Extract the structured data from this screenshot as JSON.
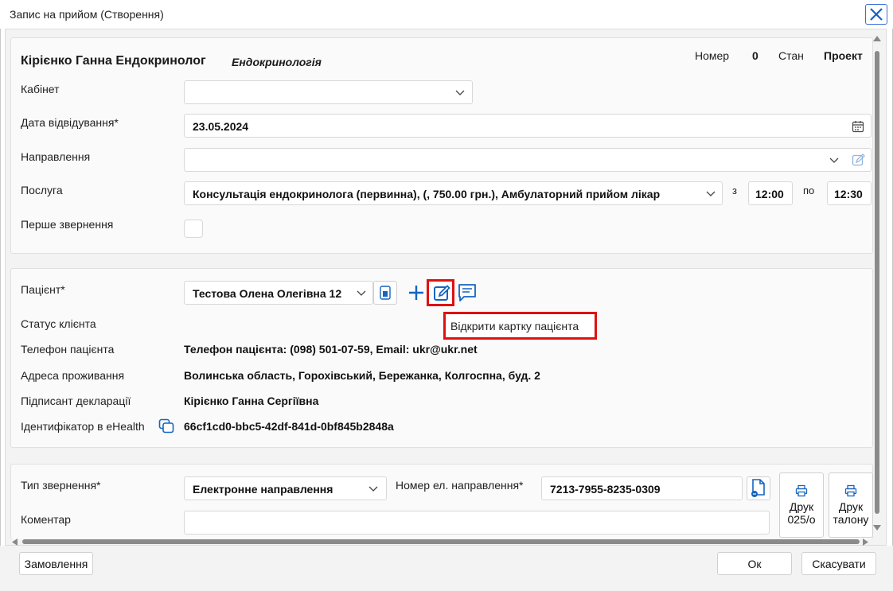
{
  "window": {
    "title": "Запис на прийом (Створення)"
  },
  "header": {
    "doctor": "Кірієнко Ганна Ендокринолог",
    "specialty": "Ендокринологія",
    "number_label": "Номер",
    "number_value": "0",
    "state_label": "Стан",
    "state_value": "Проект"
  },
  "form": {
    "cabinet_label": "Кабінет",
    "cabinet_value": "",
    "date_label": "Дата відвідування*",
    "date_value": "23.05.2024",
    "referral_label": "Направлення",
    "referral_value": "",
    "service_label": "Послуга",
    "service_value": "Консультація ендокринолога (первинна), (, 750.00 грн.), Амбулаторний прийом лікар",
    "from_label": "з",
    "from_time": "12:00",
    "to_label": "по",
    "to_time": "12:30",
    "first_visit_label": "Перше звернення"
  },
  "patient": {
    "patient_label": "Пацієнт*",
    "patient_value": "Тестова Олена Олегівна 12",
    "tooltip": "Відкрити картку пацієнта",
    "status_label": "Статус клієнта",
    "phone_label": "Телефон пацієнта",
    "phone_value": "Телефон пацієнта: (098) 501-07-59, Email: ukr@ukr.net",
    "address_label": "Адреса проживання",
    "address_value": "Волинська область, Горохівський, Бережанка, Колгоспна, буд. 2",
    "signer_label": "Підписант декларації",
    "signer_value": "Кірієнко Ганна Сергіївна",
    "ehealth_label": "Ідентифікатор в eHealth",
    "ehealth_value": "66cf1cd0-bbc5-42df-841d-0bf845b2848a"
  },
  "appeal": {
    "type_label": "Тип звернення*",
    "type_value": "Електронне направлення",
    "referral_no_label": "Номер ел. направлення*",
    "referral_no_value": "7213-7955-8235-0309",
    "comment_label": "Коментар",
    "comment_value": "",
    "print_025_line1": "Друк",
    "print_025_line2": "025/о",
    "print_talon_line1": "Друк",
    "print_talon_line2": "талону"
  },
  "footer": {
    "order_button": "Замовлення",
    "ok_button": "Ок",
    "cancel_button": "Скасувати"
  },
  "colors": {
    "accent": "#1565c0",
    "highlight": "#e01010"
  }
}
